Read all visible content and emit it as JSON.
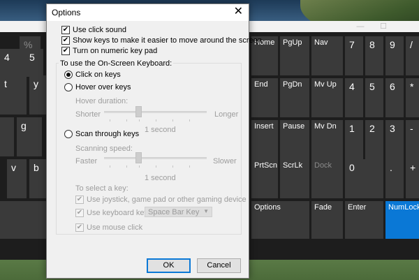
{
  "dialog": {
    "title": "Options",
    "close_glyph": "✕",
    "options": [
      {
        "label": "Use click sound",
        "checked": true
      },
      {
        "label": "Show keys to make it easier to move around the screen",
        "checked": true
      },
      {
        "label": "Turn on numeric key pad",
        "checked": true
      }
    ],
    "group_label": "To use the On-Screen Keyboard:",
    "modes": [
      {
        "label": "Click on keys",
        "selected": true
      },
      {
        "label": "Hover over keys",
        "selected": false
      },
      {
        "label": "Scan through keys",
        "selected": false
      }
    ],
    "hover": {
      "title": "Hover duration:",
      "min_label": "Shorter",
      "max_label": "Longer",
      "value_label": "1 second"
    },
    "scan": {
      "title": "Scanning speed:",
      "min_label": "Faster",
      "max_label": "Slower",
      "value_label": "1 second"
    },
    "select_key_label": "To select a key:",
    "select_options": [
      {
        "label": "Use joystick, game pad or other gaming device",
        "checked": true
      },
      {
        "label": "Use keyboard key",
        "checked": true
      },
      {
        "label": "Use mouse click",
        "checked": true
      }
    ],
    "keyboard_key_value": "Space Bar Key",
    "ok_label": "OK",
    "cancel_label": "Cancel"
  },
  "keyboard": {
    "window_controls": [
      "—",
      "☐"
    ],
    "left_keys": [
      "%",
      "4",
      "5",
      "t",
      "y",
      "g",
      "v",
      "b"
    ],
    "nav_keys": [
      "Home",
      "PgUp",
      "Nav",
      "End",
      "PgDn",
      "Mv Up",
      "Insert",
      "Pause",
      "Mv Dn",
      "PrtScn",
      "ScrLk",
      "Dock",
      "Options",
      "Fade",
      "Enter"
    ],
    "numpad_keys": [
      "7",
      "8",
      "9",
      "/",
      "4",
      "5",
      "6",
      "*",
      "1",
      "2",
      "3",
      "-",
      "0",
      ".",
      "+"
    ],
    "numlock_label": "NumLock",
    "accent_color": "#0a78d6"
  }
}
